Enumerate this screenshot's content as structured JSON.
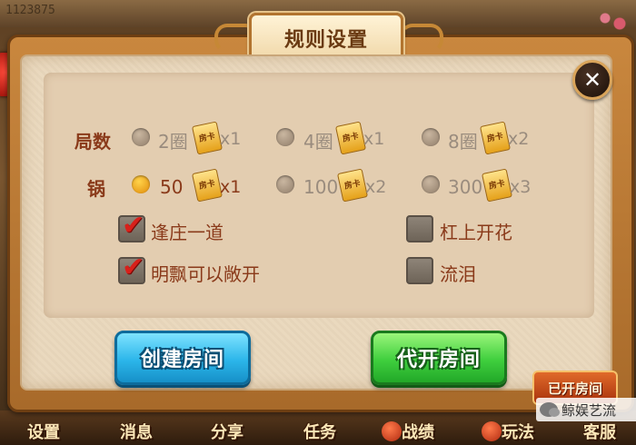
{
  "background": {
    "room_id": "1123875"
  },
  "dialog": {
    "title": "规则设置",
    "close_symbol": "✕"
  },
  "rounds": {
    "label": "局数",
    "options": [
      {
        "text": "2圈",
        "mult": "x1",
        "selected": false
      },
      {
        "text": "4圈",
        "mult": "x1",
        "selected": false
      },
      {
        "text": "8圈",
        "mult": "x2",
        "selected": false
      }
    ]
  },
  "pot": {
    "label": "锅",
    "options": [
      {
        "text": "50",
        "mult": "x1",
        "selected": true
      },
      {
        "text": "100",
        "mult": "x2",
        "selected": false
      },
      {
        "text": "300",
        "mult": "x3",
        "selected": false
      }
    ]
  },
  "card_icon_text": "房卡",
  "checks": [
    {
      "label": "逢庄一道",
      "checked": true
    },
    {
      "label": "杠上开花",
      "checked": false
    },
    {
      "label": "明飘可以敞开",
      "checked": true
    },
    {
      "label": "流泪",
      "checked": false
    }
  ],
  "buttons": {
    "create": "创建房间",
    "proxy": "代开房间",
    "opened": "已开房间"
  },
  "bottom_nav": [
    "设置",
    "消息",
    "分享",
    "任务",
    "战绩",
    "玩法",
    "客服"
  ],
  "watermark": "鲸娱艺流"
}
